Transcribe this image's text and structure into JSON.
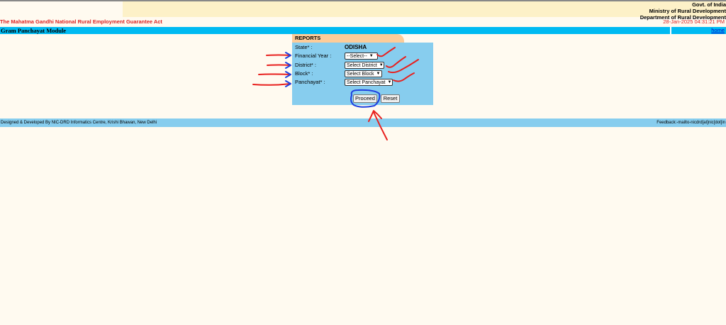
{
  "header": {
    "govt_lines": [
      "Govt. of India",
      "Ministry of Rural Development",
      "Department of Rural Development"
    ],
    "act_title": "The Mahatma Gandhi National Rural Employment Guarantee Act",
    "datetime": "28-Jan-2025 04:31:21 PM",
    "module_title": "Gram Panchayat Module",
    "home_link": "home"
  },
  "reports": {
    "heading": "REPORTS",
    "state_label": "State* :",
    "state_value": "ODISHA",
    "financial_year_label": "Financial Year :",
    "financial_year_selected": "--Select--",
    "district_label": "District* :",
    "district_selected": "Select District",
    "block_label": "Block* :",
    "block_selected": "Select Block",
    "panchayat_label": "Panchayat* :",
    "panchayat_selected": "Select Panchayat",
    "proceed_label": "Proceed",
    "reset_label": "Reset"
  },
  "footer": {
    "credit": "Designed & Developed By NIC-DRD Informatics Centre, Krishi Bhawan, New Delhi",
    "feedback": "Feedback:-mailto-nicdrd[at]nic[dot]in"
  },
  "colors": {
    "accent_bar": "#00baf2",
    "panel": "#87cdee",
    "tab": "#fdcc99",
    "header_band": "#fdf1c8",
    "act_text": "#dd2222",
    "annotation_red": "#e8201e",
    "annotation_blue": "#1e3fe0"
  }
}
